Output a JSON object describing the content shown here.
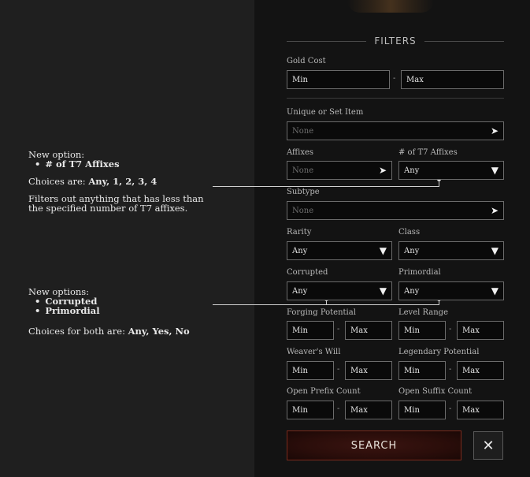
{
  "notes": {
    "t7": {
      "heading": "New option:",
      "item": "# of T7 Affixes",
      "choices_prefix": "Choices are: ",
      "choices_values": "Any, 1, 2, 3, 4",
      "desc_line1": "Filters out anything that has less than",
      "desc_line2": "the specified number of T7 affixes."
    },
    "corrupted": {
      "heading": "New options:",
      "item1": "Corrupted",
      "item2": "Primordial",
      "choices_prefix": "Choices for both are: ",
      "choices_values": "Any, Yes, No"
    }
  },
  "filters": {
    "title": "FILTERS",
    "gold_cost": {
      "label": "Gold Cost",
      "min": "Min",
      "max": "Max",
      "sep": "-"
    },
    "unique_set": {
      "label": "Unique or Set Item",
      "value": "None"
    },
    "affixes": {
      "label": "Affixes",
      "value": "None"
    },
    "t7_affixes": {
      "label": "# of T7 Affixes",
      "value": "Any"
    },
    "subtype": {
      "label": "Subtype",
      "value": "None"
    },
    "rarity": {
      "label": "Rarity",
      "value": "Any"
    },
    "class": {
      "label": "Class",
      "value": "Any"
    },
    "corrupted": {
      "label": "Corrupted",
      "value": "Any"
    },
    "primordial": {
      "label": "Primordial",
      "value": "Any"
    },
    "forging_potential": {
      "label": "Forging Potential",
      "min": "Min",
      "max": "Max",
      "sep": "-"
    },
    "level_range": {
      "label": "Level Range",
      "min": "Min",
      "max": "Max",
      "sep": "-"
    },
    "weavers_will": {
      "label": "Weaver's Will",
      "min": "Min",
      "max": "Max",
      "sep": "-"
    },
    "legendary_potential": {
      "label": "Legendary Potential",
      "min": "Min",
      "max": "Max",
      "sep": "-"
    },
    "open_prefix": {
      "label": "Open Prefix Count",
      "min": "Min",
      "max": "Max",
      "sep": "-"
    },
    "open_suffix": {
      "label": "Open Suffix Count",
      "min": "Min",
      "max": "Max",
      "sep": "-"
    }
  },
  "buttons": {
    "search": "SEARCH",
    "close": "✕"
  },
  "icons": {
    "dropdown": "chevron-down-icon",
    "next": "chevron-right-icon",
    "close": "close-icon"
  }
}
